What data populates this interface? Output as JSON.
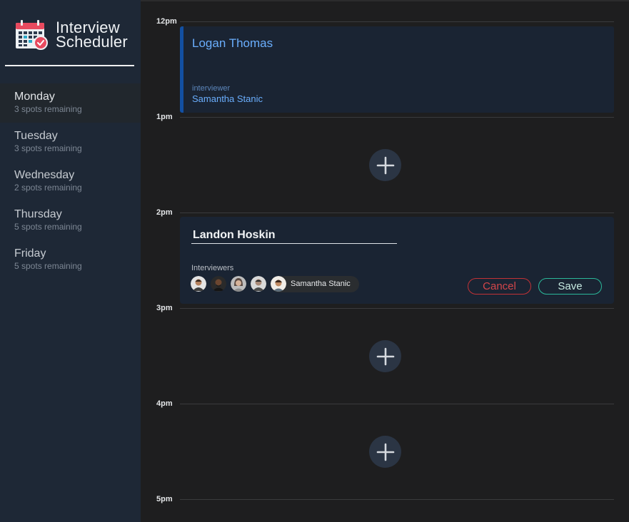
{
  "brand": {
    "title_line1": "Interview",
    "title_line2": "Scheduler",
    "logo_icon": "calendar-check-icon"
  },
  "days": [
    {
      "name": "Monday",
      "spots": "3 spots remaining",
      "selected": true
    },
    {
      "name": "Tuesday",
      "spots": "3 spots remaining",
      "selected": false
    },
    {
      "name": "Wednesday",
      "spots": "2 spots remaining",
      "selected": false
    },
    {
      "name": "Thursday",
      "spots": "5 spots remaining",
      "selected": false
    },
    {
      "name": "Friday",
      "spots": "5 spots remaining",
      "selected": false
    }
  ],
  "schedule": {
    "times": [
      "12pm",
      "1pm",
      "2pm",
      "3pm",
      "4pm",
      "5pm"
    ],
    "booked": {
      "student": "Logan Thomas",
      "interviewer_label": "interviewer",
      "interviewer": "Samantha Stanic"
    },
    "form": {
      "student_value": "Landon Hoskin",
      "interviewers_label": "Interviewers",
      "selected_interviewer": "Samantha Stanic",
      "cancel_label": "Cancel",
      "save_label": "Save"
    },
    "add_icon": "plus-icon"
  },
  "colors": {
    "sidebar_bg": "#1e2836",
    "main_bg": "#1e1e1f",
    "appointment_bg": "#1a2433",
    "booked_accent": "#1250a3",
    "link_blue": "#6aaefd",
    "danger": "#c23236",
    "success": "#2bb89a"
  }
}
